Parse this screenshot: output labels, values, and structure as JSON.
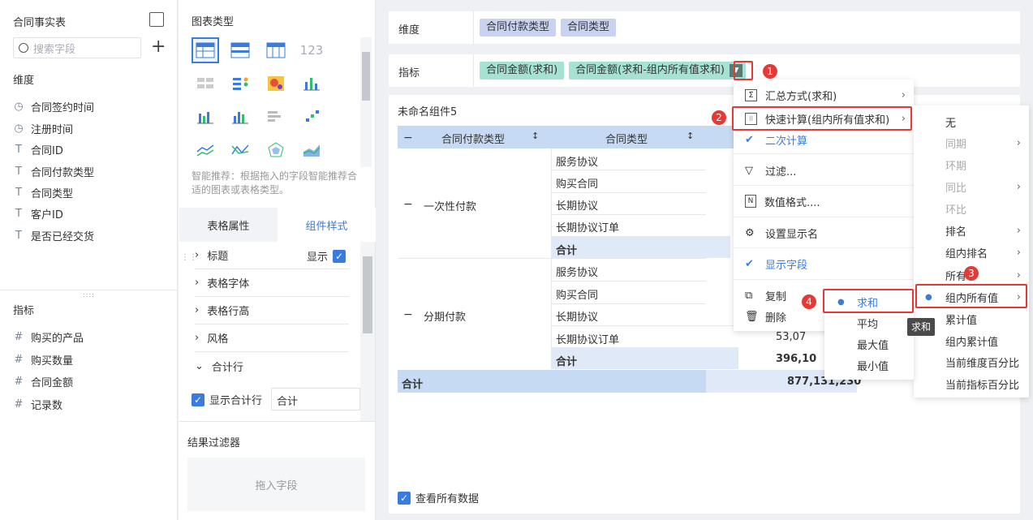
{
  "left_panel": {
    "title": "合同事实表",
    "search_placeholder": "搜索字段",
    "dim_title": "维度",
    "dimensions": [
      {
        "icon": "clock",
        "label": "合同签约时间"
      },
      {
        "icon": "clock",
        "label": "注册时间"
      },
      {
        "icon": "T",
        "label": "合同ID"
      },
      {
        "icon": "T",
        "label": "合同付款类型"
      },
      {
        "icon": "T",
        "label": "合同类型"
      },
      {
        "icon": "T",
        "label": "客户ID"
      },
      {
        "icon": "T",
        "label": "是否已经交货"
      }
    ],
    "measure_title": "指标",
    "measures": [
      {
        "icon": "#",
        "label": "购买的产品"
      },
      {
        "icon": "#",
        "label": "购买数量"
      },
      {
        "icon": "#",
        "label": "合同金额"
      },
      {
        "icon": "#",
        "label": "记录数"
      }
    ]
  },
  "mid_panel": {
    "chart_type_title": "图表类型",
    "smart_tip": "智能推荐：根据拖入的字段智能推荐合适的图表或表格类型。",
    "tab_table_props": "表格属性",
    "tab_component_style": "组件样式",
    "props": [
      "标题",
      "表格字体",
      "表格行高",
      "风格",
      "合计行"
    ],
    "show_label": "显示",
    "show_total_label": "显示合计行",
    "total_input_value": "合计",
    "result_filter_title": "结果过滤器",
    "drag_field_placeholder": "拖入字段"
  },
  "config": {
    "dim_label": "维度",
    "dim_pills": [
      "合同付款类型",
      "合同类型"
    ],
    "measure_label": "指标",
    "measure_pills": [
      "合同金额(求和)",
      "合同金额(求和-组内所有值求和)"
    ]
  },
  "widget": {
    "title": "未命名组件5",
    "table_headers": [
      "合同付款类型",
      "合同类型"
    ],
    "groups": [
      {
        "name": "一次性付款",
        "rows": [
          "服务协议",
          "购买合同",
          "长期协议",
          "长期协议订单"
        ],
        "subtotal_label": "合计"
      },
      {
        "name": "分期付款",
        "rows": [
          "服务协议",
          "购买合同",
          "长期协议",
          "长期协议订单"
        ],
        "subtotal_label": "合计"
      }
    ],
    "partial_values": [
      "53,07",
      "396,10"
    ],
    "grand_total_label": "合计",
    "grand_total_value": "877,131,230",
    "view_all_label": "查看所有数据"
  },
  "menu1": {
    "items": [
      "汇总方式(求和)",
      "快速计算(组内所有值求和)",
      "二次计算",
      "过滤...",
      "数值格式....",
      "设置显示名",
      "显示字段",
      "复制",
      "删除"
    ]
  },
  "menu2": {
    "items": [
      "无",
      "同期",
      "环期",
      "同比",
      "环比",
      "排名",
      "组内排名",
      "所有",
      "组内所有值",
      "累计值",
      "组内累计值",
      "当前维度百分比",
      "当前指标百分比"
    ]
  },
  "menu3": {
    "items": [
      "求和",
      "平均",
      "最大值",
      "最小值"
    ],
    "tooltip": "求和"
  },
  "badges": [
    "1",
    "2",
    "3",
    "4"
  ],
  "colors": {
    "accent": "#3a7be0",
    "red": "#e53935",
    "dim_pill": "#c9d3f0",
    "measure_pill": "#a6e2d4",
    "header_bg": "#c6daf3",
    "total_bg": "#dfe9f7"
  }
}
